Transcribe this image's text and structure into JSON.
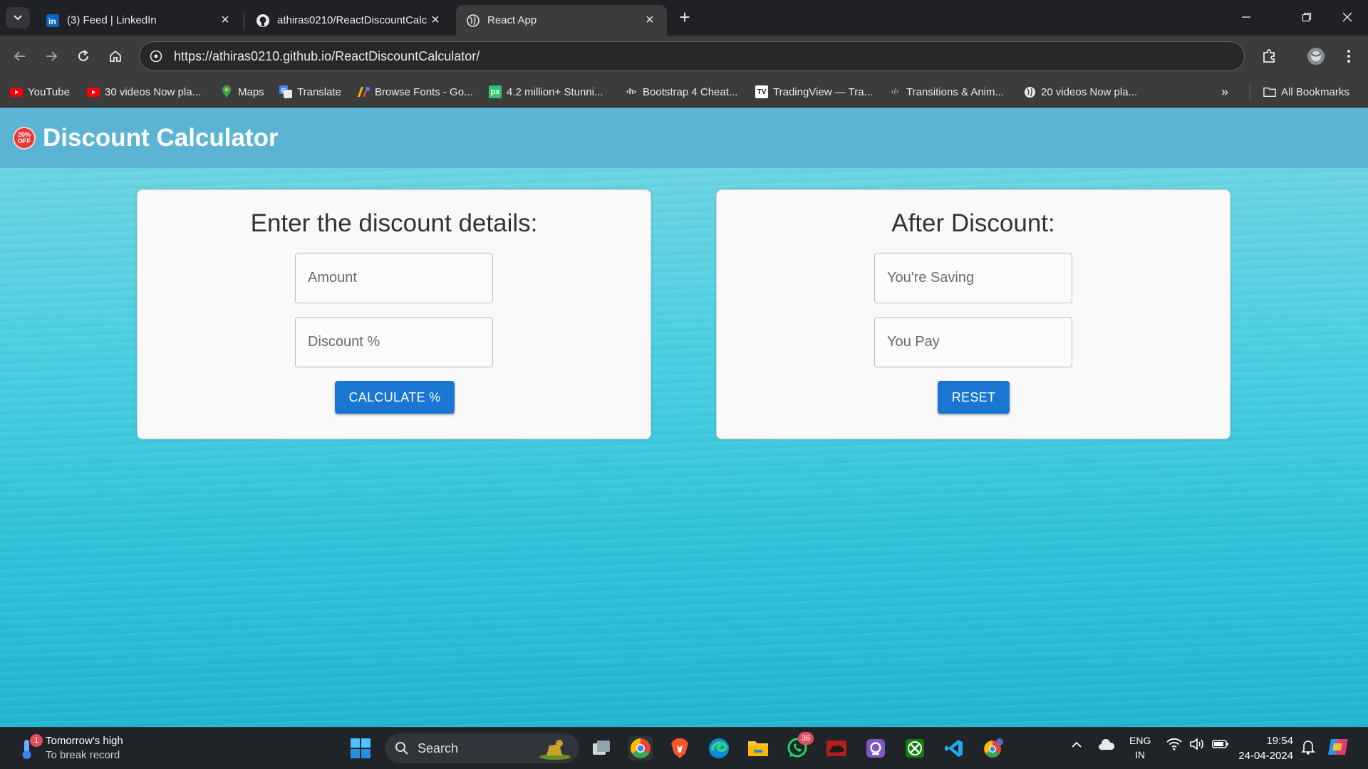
{
  "tabs": [
    {
      "title": "(3) Feed | LinkedIn",
      "icon": "linkedin-icon"
    },
    {
      "title": "athiras0210/ReactDiscountCalc",
      "icon": "github-icon"
    },
    {
      "title": "React App",
      "icon": "globe-icon"
    }
  ],
  "address_bar": {
    "url": "https://athiras0210.github.io/ReactDiscountCalculator/"
  },
  "bookmarks": [
    {
      "label": "YouTube",
      "icon": "youtube-icon"
    },
    {
      "label": "30 videos Now pla...",
      "icon": "youtube-icon"
    },
    {
      "label": "Maps",
      "icon": "maps-pin-icon"
    },
    {
      "label": "Translate",
      "icon": "translate-icon"
    },
    {
      "label": "Browse Fonts - Go...",
      "icon": "google-fonts-icon"
    },
    {
      "label": "4.2 million+ Stunni...",
      "icon": "pixabay-icon",
      "icon_text": "px"
    },
    {
      "label": "Bootstrap 4 Cheat...",
      "icon": "bootstrap-icon",
      "icon_text": "‹h›"
    },
    {
      "label": "TradingView — Tra...",
      "icon": "tradingview-icon",
      "icon_text": "TV"
    },
    {
      "label": "Transitions & Anim...",
      "icon": "code-icon",
      "icon_text": "‹/›"
    },
    {
      "label": "20 videos Now pla...",
      "icon": "globe-icon"
    }
  ],
  "all_bookmarks_label": "All Bookmarks",
  "app": {
    "badge_text": "20% OFF",
    "title": "Discount Calculator",
    "input_card": {
      "heading": "Enter the discount details:",
      "amount_placeholder": "Amount",
      "discount_placeholder": "Discount %",
      "button_label": "CALCULATE %"
    },
    "result_card": {
      "heading": "After Discount:",
      "saving_placeholder": "You're Saving",
      "pay_placeholder": "You Pay",
      "button_label": "RESET"
    },
    "colors": {
      "header": "#5bb4d3",
      "button": "#1976d2",
      "background": "#3fcbe0"
    }
  },
  "taskbar": {
    "weather": {
      "title": "Tomorrow's high",
      "subtitle": "To break record",
      "badge": "1"
    },
    "search_label": "Search",
    "whatsapp_badge": "36",
    "language": {
      "line1": "ENG",
      "line2": "IN"
    },
    "time": "19:54",
    "date": "24-04-2024"
  }
}
